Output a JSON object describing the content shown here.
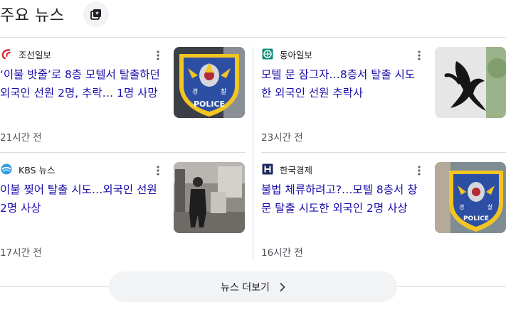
{
  "header": {
    "title": "주요 뉴스"
  },
  "articles": [
    {
      "source": "조선일보",
      "headline": "‘이불 밧줄’로 8층 모텔서 탈출하던 외국인 선원 2명, 추락… 1명 사망",
      "time": "21시간 전"
    },
    {
      "source": "동아일보",
      "headline": "모텔 문 잠그자…8층서 탈출 시도한 외국인 선원 추락사",
      "time": "23시간 전"
    },
    {
      "source": "KBS 뉴스",
      "headline": "이불 찢어 탈출 시도…외국인 선원 2명 사상",
      "time": "17시간 전"
    },
    {
      "source": "한국경제",
      "headline": "불법 체류하려고?…모텔 8층서 창문 탈출 시도한 외국인 2명 사상",
      "time": "16시간 전"
    }
  ],
  "thumbnails": {
    "police_text": "POLICE",
    "badge_left": "경",
    "badge_right": "찰"
  },
  "footer": {
    "more_label": "뉴스 더보기"
  },
  "colors": {
    "headline": "#1a0dab",
    "meta": "#4d5156",
    "divider": "#dadce0",
    "button_bg": "#f1f3f4"
  },
  "icons": {
    "header": "play-news-icon",
    "menu": "more-vert-icon",
    "more": "chevron-right-icon",
    "logos": [
      "chosun-logo",
      "donga-logo",
      "kbs-logo",
      "hankyung-logo"
    ]
  }
}
